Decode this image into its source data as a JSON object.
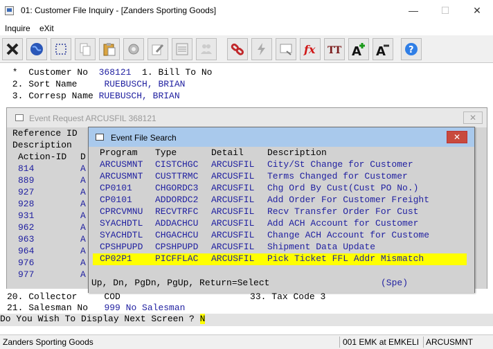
{
  "window": {
    "title": "01: Customer File Inquiry - [Zanders Sporting Goods]",
    "minimize": "—",
    "maximize": "☐",
    "close": "✕"
  },
  "menu": [
    "Inquire",
    "eXit"
  ],
  "toolbar": {
    "icons": [
      "close-icon",
      "globe-icon",
      "select-icon",
      "copy-icon",
      "paste-icon",
      "settings-icon",
      "edit-icon",
      "list-icon",
      "people-icon",
      "link-icon",
      "lightning-icon",
      "screen-icon",
      "function-icon",
      "font-icon",
      "font-increase-icon",
      "font-decrease-icon",
      "help-icon"
    ],
    "fx_label": "fx",
    "font_label": "TT",
    "font_inc": "A",
    "font_dec": "A",
    "help": "?"
  },
  "terminal": {
    "row1": {
      "prefix": " *  Customer No  ",
      "value": "368121",
      "suffix": "  1. Bill To No"
    },
    "row2": {
      "prefix": " 2. Sort Name     ",
      "value": "RUEBUSCH, BRIAN"
    },
    "row3": {
      "prefix": " 3. Corresp Name ",
      "value": "RUEBUSCH, BRIAN"
    },
    "row20": "20. Collector     COD                        33. Tax Code 3",
    "row21": {
      "prefix": "21. Salesman No   ",
      "value": "999 No Salesman"
    },
    "prompt": "Do You Wish To Display Next Screen ? ",
    "prompt_answer": "N"
  },
  "event_window": {
    "title": "Event Request ARCUSFIL 368121",
    "close": "✕",
    "reference_label": "Reference ID",
    "description_label": "Description",
    "col_action": "Action-ID",
    "col_d": "D",
    "actions": [
      {
        "id": "814",
        "d": "A"
      },
      {
        "id": "889",
        "d": "A"
      },
      {
        "id": "927",
        "d": "A"
      },
      {
        "id": "928",
        "d": "A"
      },
      {
        "id": "931",
        "d": "A"
      },
      {
        "id": "962",
        "d": "A"
      },
      {
        "id": "963",
        "d": "A"
      },
      {
        "id": "964",
        "d": "A"
      },
      {
        "id": "976",
        "d": "A"
      },
      {
        "id": "977",
        "d": "A"
      }
    ]
  },
  "search_dialog": {
    "title": "Event File Search",
    "close": "✕",
    "headers": {
      "program": "Program",
      "type": "Type",
      "detail": "Detail",
      "description": "Description"
    },
    "rows": [
      {
        "program": "ARCUSMNT",
        "type": "CISTCHGC",
        "detail": "ARCUSFIL",
        "description": "City/St Change for Customer"
      },
      {
        "program": "ARCUSMNT",
        "type": "CUSTTRMC",
        "detail": "ARCUSFIL",
        "description": "Terms Changed for Customer"
      },
      {
        "program": "CP0101",
        "type": "CHGORDC3",
        "detail": "ARCUSFIL",
        "description": "Chg Ord By Cust(Cust PO No.)"
      },
      {
        "program": "CP0101",
        "type": "ADDORDC2",
        "detail": "ARCUSFIL",
        "description": "Add Order For Customer Freight"
      },
      {
        "program": "CPRCVMNU",
        "type": "RECVTRFC",
        "detail": "ARCUSFIL",
        "description": "Recv Transfer Order For Cust"
      },
      {
        "program": "SYACHDTL",
        "type": "ADDACHCU",
        "detail": "ARCUSFIL",
        "description": "Add ACH Account for Customer"
      },
      {
        "program": "SYACHDTL",
        "type": "CHGACHCU",
        "detail": "ARCUSFIL",
        "description": "Change ACH Account for Custome"
      },
      {
        "program": "CPSHPUPD",
        "type": "CPSHPUPD",
        "detail": "ARCUSFIL",
        "description": "Shipment Data Update"
      },
      {
        "program": "CP02P1",
        "type": "PICFFLAC",
        "detail": "ARCUSFIL",
        "description": "Pick Ticket FFL Addr Mismatch",
        "selected": true
      }
    ],
    "footer_keys": "Up, Dn, PgDn, PgUp, Return=Select",
    "footer_mode": "(Spe)"
  },
  "statusbar": {
    "company": "Zanders Sporting Goods",
    "session": "001 EMK at EMKELI",
    "program": "ARCUSMNT"
  },
  "colors": {
    "field_value": "#1f1fa0",
    "highlight": "#ffff00",
    "dialog_title": "#a9c9ec",
    "close_red": "#c84a3e"
  }
}
